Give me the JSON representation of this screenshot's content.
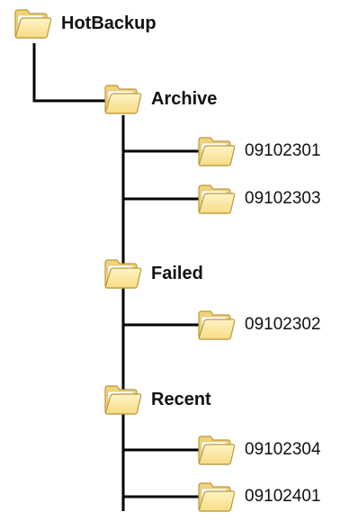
{
  "tree": {
    "root": {
      "label": "HotBackup",
      "icon": "folder-icon",
      "children": [
        {
          "label": "Archive",
          "icon": "folder-icon",
          "children": [
            {
              "label": "09102301",
              "icon": "folder-icon"
            },
            {
              "label": "09102303",
              "icon": "folder-icon"
            }
          ]
        },
        {
          "label": "Failed",
          "icon": "folder-icon",
          "children": [
            {
              "label": "09102302",
              "icon": "folder-icon"
            }
          ]
        },
        {
          "label": "Recent",
          "icon": "folder-icon",
          "children": [
            {
              "label": "09102304",
              "icon": "folder-icon"
            },
            {
              "label": "09102401",
              "icon": "folder-icon"
            }
          ]
        }
      ]
    }
  },
  "colors": {
    "connector": "#000000",
    "folder_fill": "#f7dc85",
    "folder_stroke": "#b99a3a",
    "text": "#111111"
  }
}
